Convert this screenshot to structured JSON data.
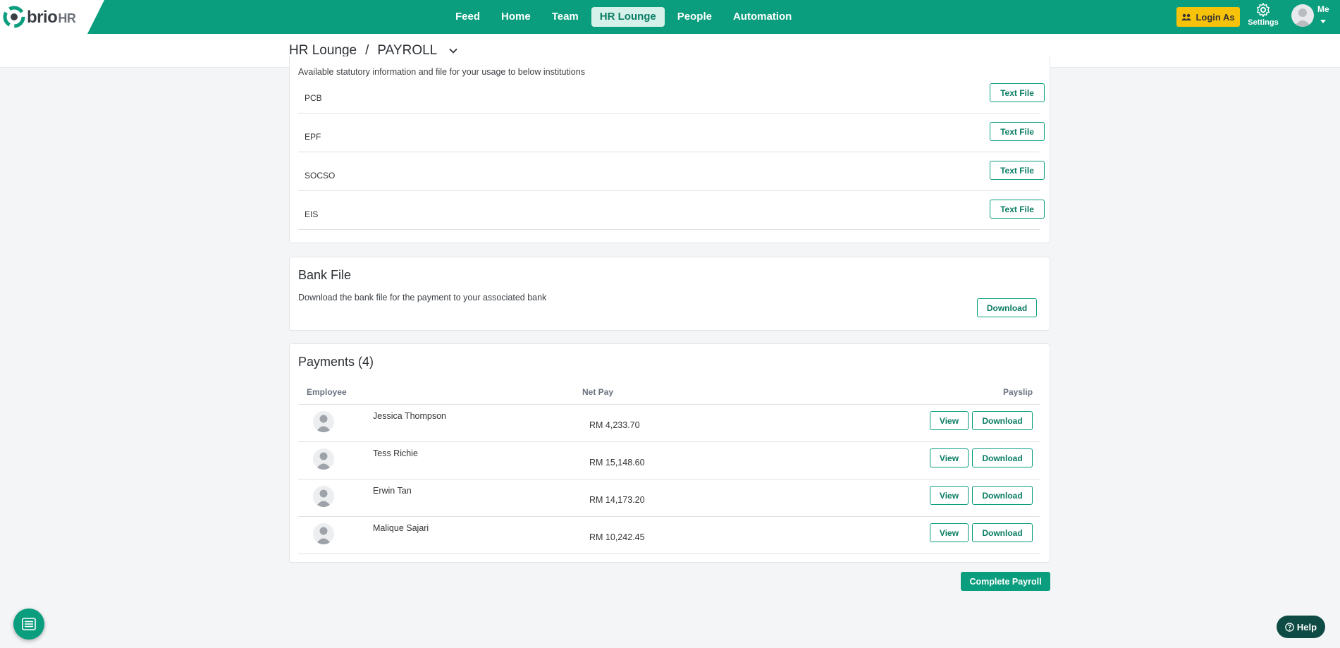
{
  "brand": {
    "name": "brio",
    "suffix": "HR",
    "color": "#0a9e7e"
  },
  "nav": {
    "items": [
      {
        "label": "Feed"
      },
      {
        "label": "Home"
      },
      {
        "label": "Team"
      },
      {
        "label": "HR Lounge",
        "active": true
      },
      {
        "label": "People"
      },
      {
        "label": "Automation"
      }
    ]
  },
  "header": {
    "login_as": "Login As",
    "settings": "Settings",
    "user": "Me"
  },
  "breadcrumb": {
    "root": "HR Lounge",
    "separator": "/",
    "current": "PAYROLL"
  },
  "statutory": {
    "description": "Available statutory information and file for your usage to below institutions",
    "rows": [
      {
        "name": "PCB",
        "button": "Text File"
      },
      {
        "name": "EPF",
        "button": "Text File"
      },
      {
        "name": "SOCSO",
        "button": "Text File"
      },
      {
        "name": "EIS",
        "button": "Text File"
      }
    ]
  },
  "bank": {
    "title": "Bank File",
    "description": "Download the bank file for the payment to your associated bank",
    "button": "Download"
  },
  "payments": {
    "title": "Payments (4)",
    "columns": {
      "employee": "Employee",
      "net_pay": "Net Pay",
      "payslip": "Payslip"
    },
    "rows": [
      {
        "name": "Jessica Thompson",
        "net_pay": "RM 4,233.70",
        "view": "View",
        "download": "Download"
      },
      {
        "name": "Tess Richie",
        "net_pay": "RM 15,148.60",
        "view": "View",
        "download": "Download"
      },
      {
        "name": "Erwin Tan",
        "net_pay": "RM 14,173.20",
        "view": "View",
        "download": "Download"
      },
      {
        "name": "Malique Sajari",
        "net_pay": "RM 10,242.45",
        "view": "View",
        "download": "Download"
      }
    ]
  },
  "complete_button": "Complete Payroll",
  "help_button": "Help",
  "icons": [
    "brio-logo-icon",
    "users-icon",
    "gear-icon",
    "avatar-icon",
    "chevron-down-icon",
    "menu-icon",
    "help-circle-icon"
  ]
}
